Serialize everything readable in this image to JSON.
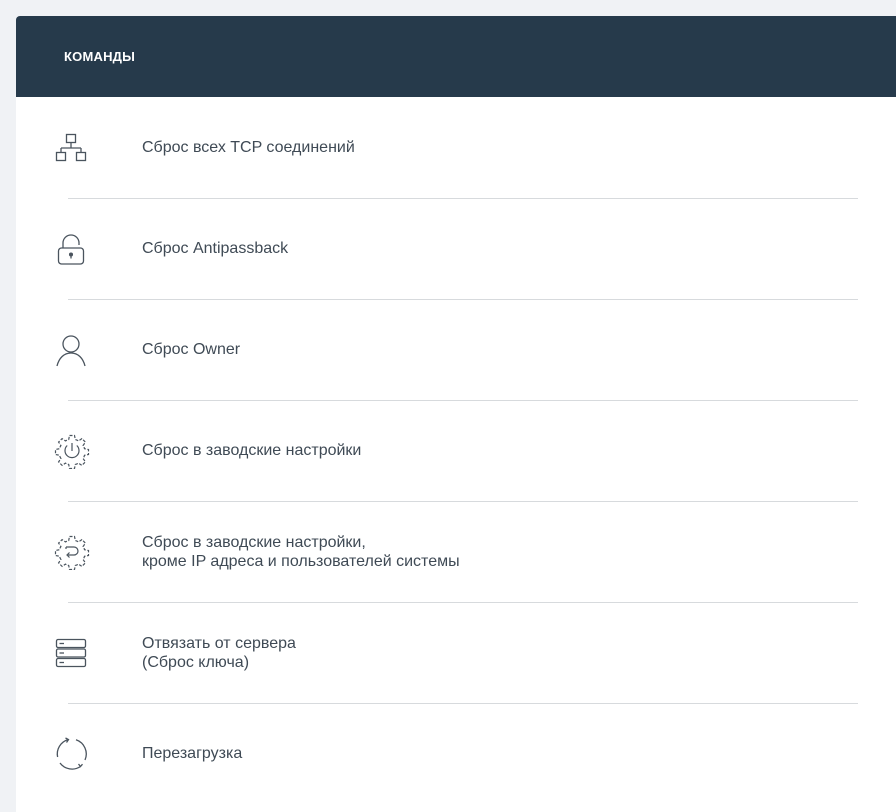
{
  "header": {
    "title": "КОМАНДЫ"
  },
  "commands": [
    {
      "icon": "network-icon",
      "lines": [
        "Сброс всех TCP соединений"
      ]
    },
    {
      "icon": "unlock-icon",
      "lines": [
        "Сброс Antipassback"
      ]
    },
    {
      "icon": "user-icon",
      "lines": [
        "Сброс Owner"
      ]
    },
    {
      "icon": "gear-power-icon",
      "lines": [
        "Сброс в заводские настройки"
      ]
    },
    {
      "icon": "gear-reset-icon",
      "lines": [
        "Сброс в заводские настройки,",
        "кроме IP адреса и пользователей системы"
      ]
    },
    {
      "icon": "server-icon",
      "lines": [
        "Отвязать от сервера",
        "(Сброс ключа)"
      ]
    },
    {
      "icon": "refresh-icon",
      "lines": [
        "Перезагрузка"
      ]
    }
  ],
  "colors": {
    "header_bg": "#263a4b",
    "icon_stroke": "#4a545e",
    "text": "#3f4a55",
    "divider": "#d7dadd"
  }
}
